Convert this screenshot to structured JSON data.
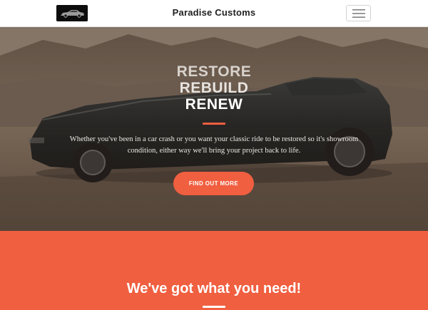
{
  "navbar": {
    "brand": "Paradise Customs",
    "logo_icon": "car-logo-icon",
    "menu_icon": "hamburger-menu-icon"
  },
  "hero": {
    "headline": [
      "RESTORE",
      "REBUILD",
      "RENEW"
    ],
    "description": "Whether you've been in a car crash or you want your classic ride to be restored so it's showroom condition, either way we'll bring your project back to life.",
    "cta_label": "FIND OUT MORE"
  },
  "services": {
    "title": "We've got what you need!"
  },
  "colors": {
    "accent": "#f05f40",
    "navbar_bg": "#ffffff",
    "text_light": "#ffffff"
  }
}
